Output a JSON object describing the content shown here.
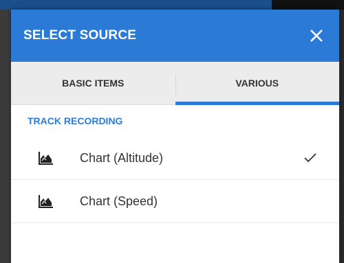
{
  "dialog": {
    "title": "SELECT SOURCE",
    "close_icon": "close-icon",
    "accent_color": "#2b7bd6"
  },
  "tabs": [
    {
      "label": "BASIC ITEMS",
      "active": false
    },
    {
      "label": "VARIOUS",
      "active": true
    }
  ],
  "section": {
    "title": "TRACK RECORDING"
  },
  "items": [
    {
      "label": "Chart (Altitude)",
      "icon": "chart-area-icon",
      "selected": true
    },
    {
      "label": "Chart (Speed)",
      "icon": "chart-area-icon",
      "selected": false
    }
  ]
}
